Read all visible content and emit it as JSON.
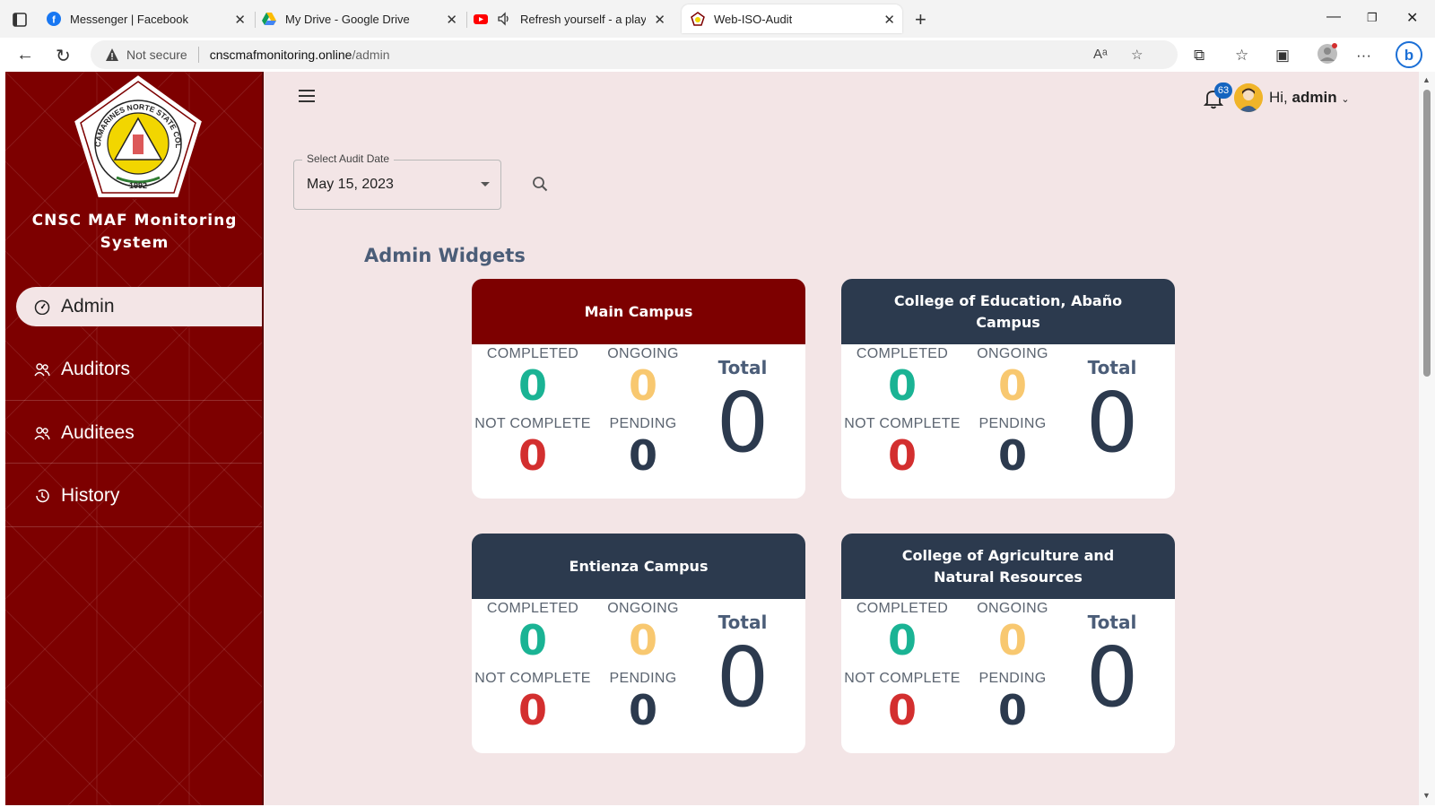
{
  "browser": {
    "tabs": [
      {
        "title": "Messenger | Facebook"
      },
      {
        "title": "My Drive - Google Drive"
      },
      {
        "title": "Refresh yourself - a playlist"
      },
      {
        "title": "Web-ISO-Audit"
      }
    ],
    "security_label": "Not secure",
    "url_host": "cnscmafmonitoring.online",
    "url_path": "/admin"
  },
  "sidebar": {
    "brand_line1": "CNSC MAF Monitoring",
    "brand_line2": "System",
    "logo_text": "CAMARINES NORTE STATE COLLEGE",
    "logo_year": "1992",
    "items": [
      {
        "label": "Admin",
        "icon": "dashboard-icon",
        "active": true
      },
      {
        "label": "Auditors",
        "icon": "users-icon"
      },
      {
        "label": "Auditees",
        "icon": "users-icon"
      },
      {
        "label": "History",
        "icon": "history-icon"
      }
    ]
  },
  "header": {
    "notification_count": "63",
    "greeting": "Hi,",
    "username": "admin"
  },
  "filter": {
    "label": "Select Audit Date",
    "value": "May 15, 2023"
  },
  "widgets": {
    "title": "Admin Widgets",
    "labels": {
      "completed": "COMPLETED",
      "ongoing": "ONGOING",
      "not_complete": "NOT COMPLETE",
      "pending": "PENDING",
      "total": "Total"
    },
    "cards": [
      {
        "campus": "Main Campus",
        "completed": "0",
        "ongoing": "0",
        "not_complete": "0",
        "pending": "0",
        "total": "0",
        "header_color": "#7d0000"
      },
      {
        "campus": "College of Education, Abaño Campus",
        "completed": "0",
        "ongoing": "0",
        "not_complete": "0",
        "pending": "0",
        "total": "0",
        "header_color": "#2c3a4e"
      },
      {
        "campus": "Entienza Campus",
        "completed": "0",
        "ongoing": "0",
        "not_complete": "0",
        "pending": "0",
        "total": "0",
        "header_color": "#2c3a4e"
      },
      {
        "campus": "College of Agriculture and Natural Resources",
        "completed": "0",
        "ongoing": "0",
        "not_complete": "0",
        "pending": "0",
        "total": "0",
        "header_color": "#2c3a4e"
      }
    ]
  },
  "colors": {
    "completed": "#1ab394",
    "ongoing": "#f8c870",
    "not_complete": "#d32f2f",
    "pending": "#2c3a4e"
  }
}
